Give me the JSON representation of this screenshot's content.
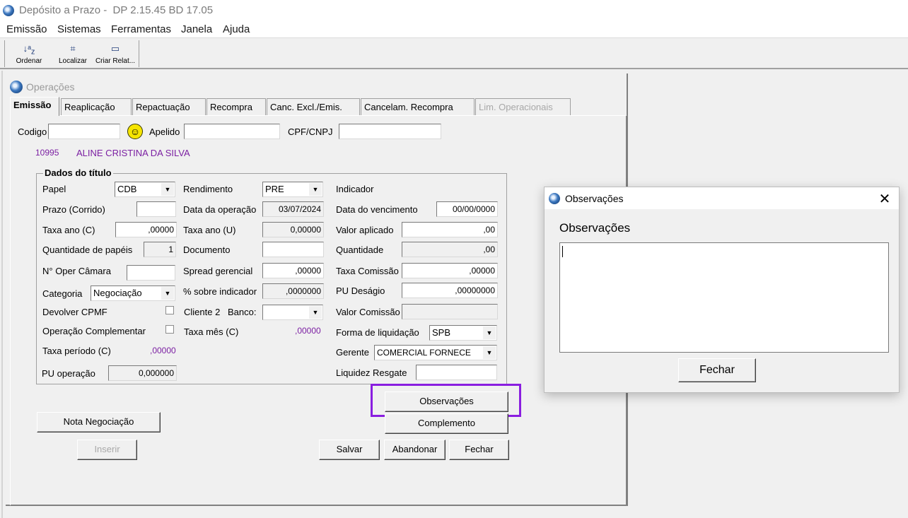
{
  "window": {
    "title": "Depósito a Prazo -  DP 2.15.45 BD 17.05"
  },
  "menu": [
    "Emissão",
    "Sistemas",
    "Ferramentas",
    "Janela",
    "Ajuda"
  ],
  "toolbar": {
    "sort": "Ordenar",
    "find": "Localizar",
    "report": "Criar Relat..."
  },
  "child_window": {
    "title": "Operações"
  },
  "tabs": [
    "Emissão",
    "Reaplicação",
    "Repactuação",
    "Recompra",
    "Canc. Excl./Emis.",
    "Cancelam. Recompra",
    "Lim. Operacionais"
  ],
  "search": {
    "codigo_label": "Codigo",
    "apelido_label": "Apelido",
    "cpf_label": "CPF/CNPJ"
  },
  "client": {
    "code": "10995",
    "name": "ALINE CRISTINA DA SILVA"
  },
  "group_title": "Dados do título",
  "labels": {
    "papel": "Papel",
    "prazo": "Prazo (Corrido)",
    "taxa_ano_c": "Taxa ano (C)",
    "qtd_papeis": "Quantidade de papéis",
    "oper_camara": "N° Oper Câmara",
    "categoria": "Categoria",
    "devolver_cpmf": "Devolver CPMF",
    "op_complementar": "Operação Complementar",
    "taxa_periodo": "Taxa período (C)",
    "pu_operacao": "PU operação",
    "rendimento": "Rendimento",
    "data_operacao": "Data da operação",
    "taxa_ano_u": "Taxa ano (U)",
    "documento": "Documento",
    "spread": "Spread gerencial",
    "perc_indicador": "% sobre indicador",
    "cliente2": "Cliente 2",
    "banco": "Banco:",
    "taxa_mes": "Taxa mês (C)",
    "indicador": "Indicador",
    "data_vencimento": "Data do vencimento",
    "valor_aplicado": "Valor aplicado",
    "quantidade": "Quantidade",
    "taxa_comissao": "Taxa Comissão",
    "pu_desagio": "PU Deságio",
    "valor_comissao": "Valor Comissão",
    "forma_liquidacao": "Forma de liquidação",
    "gerente": "Gerente",
    "liquidez": "Liquidez Resgate"
  },
  "values": {
    "papel": "CDB",
    "taxa_ano_c": ",00000",
    "qtd_papeis": "1",
    "categoria": "Negociação",
    "taxa_periodo": ",00000",
    "pu_operacao": "0,000000",
    "rendimento": "PRE",
    "data_operacao": "03/07/2024",
    "taxa_ano_u": "0,00000",
    "spread": ",00000",
    "perc_indicador": ",0000000",
    "taxa_mes": ",00000",
    "data_vencimento": "00/00/0000",
    "valor_aplicado": ",00",
    "quantidade": ",00",
    "taxa_comissao": ",00000",
    "pu_desagio": ",00000000",
    "forma_liquidacao": "SPB",
    "gerente": "COMERCIAL FORNECE"
  },
  "buttons": {
    "observacoes": "Observações",
    "complemento": "Complemento",
    "nota": "Nota Negociação",
    "inserir": "Inserir",
    "salvar": "Salvar",
    "abandonar": "Abandonar",
    "fechar": "Fechar"
  },
  "dialog": {
    "title": "Observações",
    "label": "Observações",
    "text": "",
    "close_button": "Fechar"
  },
  "colors": {
    "highlight": "#8a1ee0",
    "client_text": "#7b1fa2"
  }
}
